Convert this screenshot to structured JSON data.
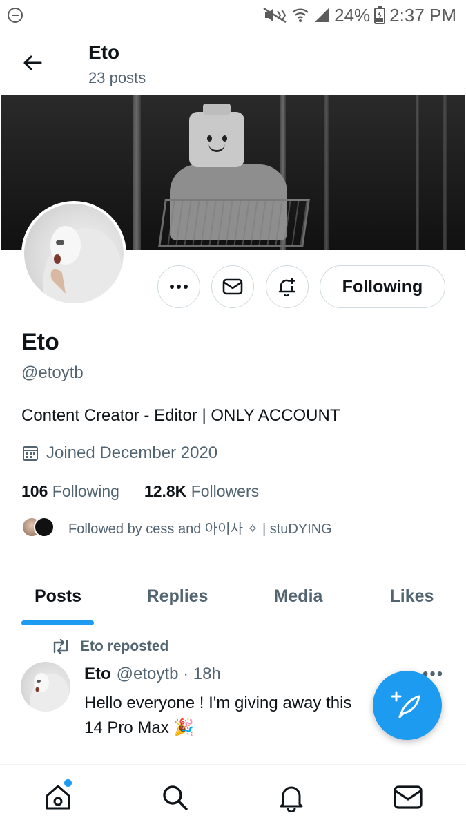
{
  "status_bar": {
    "battery": "24%",
    "time": "2:37 PM"
  },
  "header": {
    "name": "Eto",
    "posts_count": "23 posts"
  },
  "actions": {
    "following_label": "Following"
  },
  "profile": {
    "name": "Eto",
    "handle": "@etoytb",
    "bio": "Content Creator - Editor | ONLY ACCOUNT",
    "joined": "Joined December 2020",
    "following_count": "106",
    "following_label": "Following",
    "followers_count": "12.8K",
    "followers_label": "Followers",
    "followed_by": "Followed by cess and 아이사 ✧ | stuDYING"
  },
  "tabs": [
    {
      "label": "Posts"
    },
    {
      "label": "Replies"
    },
    {
      "label": "Media"
    },
    {
      "label": "Likes"
    }
  ],
  "post": {
    "repost_label": "Eto reposted",
    "author_name": "Eto",
    "author_meta": "@etoytb · 18h",
    "text": "Hello everyone ! I'm giving away this 14 Pro Max 🎉"
  },
  "colors": {
    "accent": "#1d9bf0",
    "secondary_text": "#536471",
    "primary_text": "#0f1419"
  }
}
